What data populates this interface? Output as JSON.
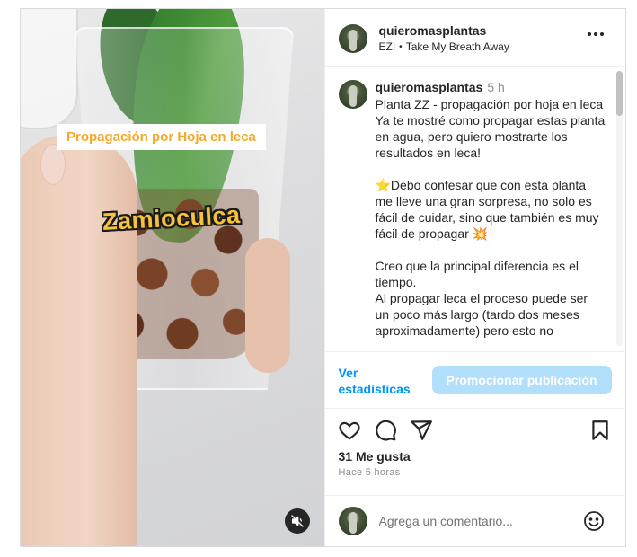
{
  "media": {
    "overlay_title": "Propagación por Hoja en leca",
    "overlay_plant": "Zamioculca",
    "mute_icon": "speaker-muted-icon"
  },
  "header": {
    "username": "quieromasplantas",
    "audio_artist": "EZI",
    "audio_separator": "•",
    "audio_track": "Take My Breath Away",
    "more_icon": "more-horizontal-icon"
  },
  "caption": {
    "username": "quieromasplantas",
    "time": "5 h",
    "text": "Planta ZZ - propagación por hoja en leca\nYa te mostré como propagar estas planta en agua, pero quiero mostrarte los resultados en leca!\n\n⭐Debo confesar que con esta planta me lleve una gran sorpresa, no solo es fácil de cuidar, sino que también es muy fácil de propagar 💥\n\nCreo que la principal diferencia es el tiempo.\nAl propagar leca el proceso puede ser un poco más largo (tardo dos meses aproximadamente) pero esto no"
  },
  "promo": {
    "stats_label": "Ver estadísticas",
    "promote_label": "Promocionar publicación"
  },
  "actions": {
    "like_icon": "heart-icon",
    "comment_icon": "comment-icon",
    "share_icon": "send-icon",
    "save_icon": "bookmark-icon"
  },
  "likes": "31 Me gusta",
  "posted": "Hace 5 horas",
  "comment": {
    "placeholder": "Agrega un comentario...",
    "emoji_icon": "emoji-smile-icon"
  },
  "colors": {
    "accent": "#0095f6",
    "promote_bg": "#b2dffc",
    "overlay_title_text": "#f4a92a",
    "overlay_plant_text": "#f6c23b"
  }
}
